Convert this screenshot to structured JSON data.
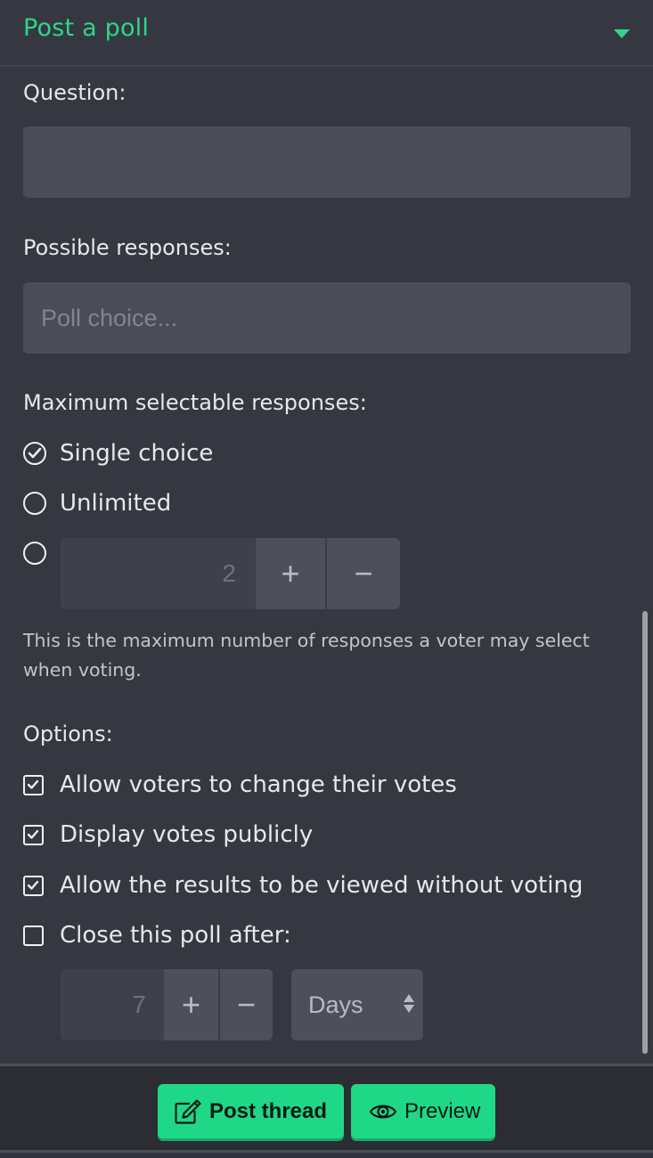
{
  "header": {
    "title": "Post a poll",
    "toggle_icon": "caret-down-icon",
    "accent_color": "#2fd58a"
  },
  "question": {
    "label": "Question:",
    "value": "",
    "placeholder": ""
  },
  "responses": {
    "label": "Possible responses:",
    "value": "",
    "placeholder": "Poll choice..."
  },
  "max_selectable": {
    "label": "Maximum selectable responses:",
    "options": [
      {
        "label": "Single choice",
        "selected": true
      },
      {
        "label": "Unlimited",
        "selected": false
      },
      {
        "label": "",
        "selected": false
      }
    ],
    "custom_value": "2",
    "increment_label": "+",
    "decrement_label": "−",
    "help_text": "This is the maximum number of responses a voter may select when voting."
  },
  "options": {
    "label": "Options:",
    "items": [
      {
        "label": "Allow voters to change their votes",
        "checked": true
      },
      {
        "label": "Display votes publicly",
        "checked": true
      },
      {
        "label": "Allow the results to be viewed without voting",
        "checked": true
      },
      {
        "label": "Close this poll after:",
        "checked": false
      }
    ],
    "close_after": {
      "value": "7",
      "increment_label": "+",
      "decrement_label": "−",
      "unit_selected": "Days"
    }
  },
  "footer": {
    "post_button": {
      "label": "Post thread",
      "icon": "edit-icon"
    },
    "preview_button": {
      "label": "Preview",
      "icon": "eye-icon"
    },
    "button_color": "#1fd887"
  }
}
